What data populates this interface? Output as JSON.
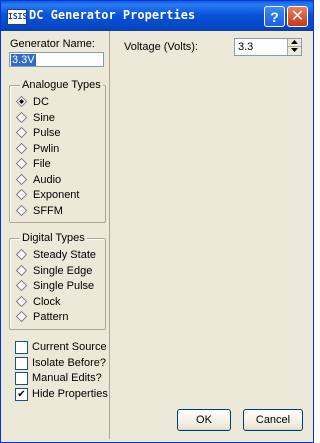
{
  "window": {
    "icon_text": "ISIS",
    "title": "DC Generator Properties"
  },
  "left": {
    "generator_name_label": "Generator Name:",
    "generator_name_value": "3.3V",
    "analogue": {
      "title": "Analogue Types",
      "options": [
        "DC",
        "Sine",
        "Pulse",
        "Pwlin",
        "File",
        "Audio",
        "Exponent",
        "SFFM"
      ],
      "selected": "DC"
    },
    "digital": {
      "title": "Digital Types",
      "options": [
        "Steady State",
        "Single Edge",
        "Single Pulse",
        "Clock",
        "Pattern"
      ]
    },
    "checks": [
      {
        "label": "Current Source",
        "checked": false
      },
      {
        "label": "Isolate Before?",
        "checked": false
      },
      {
        "label": "Manual Edits?",
        "checked": false
      },
      {
        "label": "Hide Properties",
        "checked": true
      }
    ]
  },
  "right": {
    "voltage_label": "Voltage (Volts):",
    "voltage_value": "3.3"
  },
  "buttons": {
    "ok": "OK",
    "cancel": "Cancel"
  },
  "colors": {
    "title_bar": "#0b54d8",
    "selection": "#316ac5",
    "close_button": "#c3391b"
  }
}
